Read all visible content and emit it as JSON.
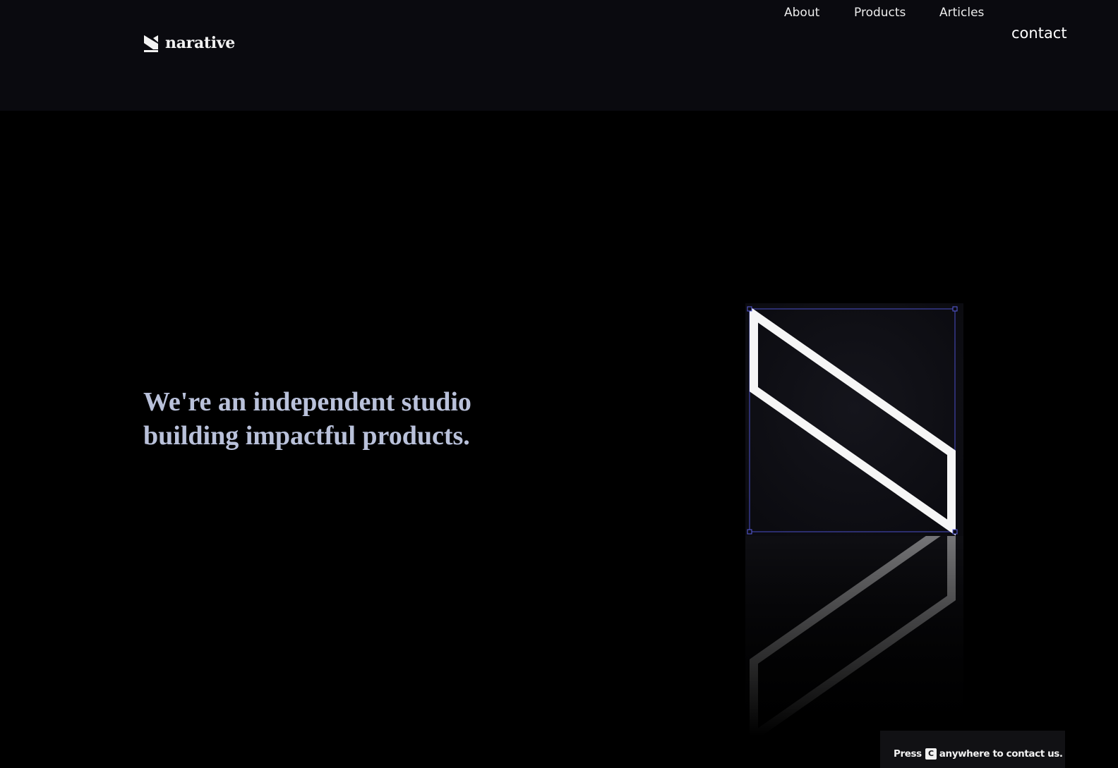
{
  "header": {
    "brand": "narative",
    "nav": [
      {
        "label": "About"
      },
      {
        "label": "Products"
      },
      {
        "label": "Articles"
      }
    ],
    "contact_label": "contact"
  },
  "hero": {
    "line1": "We're an independent studio",
    "line2": "building impactful products."
  },
  "hint": {
    "prefix": "Press",
    "key": "C",
    "suffix": "anywhere to contact us."
  },
  "colors": {
    "background": "#000000",
    "header_background": "#0a0a0f",
    "hero_text": "#b9c1da",
    "selection_outline": "#4a4ec8"
  },
  "icons": {
    "logo": "narative-n-logo-icon",
    "illustration": "narative-n-outline-icon"
  }
}
